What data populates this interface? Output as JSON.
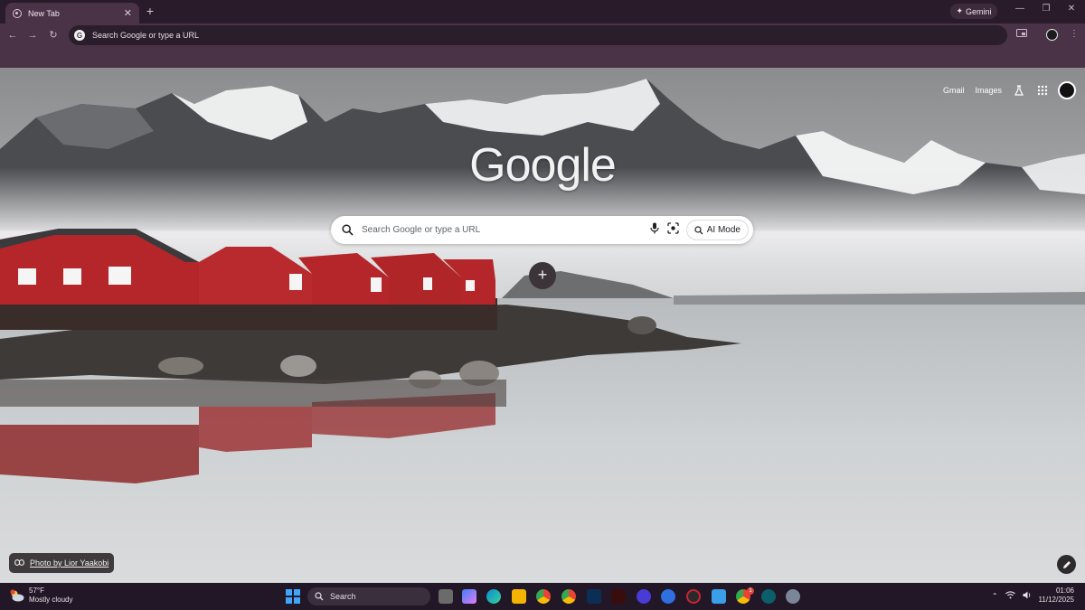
{
  "tabs": [
    {
      "title": "New Tab"
    }
  ],
  "gemini": {
    "label": "Gemini"
  },
  "omnibox": {
    "text": "Search Google or type a URL"
  },
  "ntp": {
    "top_links": {
      "gmail": "Gmail",
      "images": "Images"
    },
    "logo_text": "Google",
    "search": {
      "placeholder": "Search Google or type a URL",
      "ai_mode": "AI Mode"
    },
    "photo_credit": "Photo by Lior Yaakobi"
  },
  "icons": [
    "mic-icon",
    "lens-icon",
    "labs-icon",
    "apps-icon",
    "pencil-icon",
    "link-icon"
  ],
  "taskbar": {
    "weather_temp": "57°F",
    "weather_desc": "Mostly cloudy",
    "search_label": "Search",
    "time": "01:06",
    "date": "11/12/2025",
    "notification_badge": "1"
  },
  "colors": {
    "frame": "#2a1b2b",
    "toolbar": "#4a3347",
    "taskbar": "#221726"
  }
}
